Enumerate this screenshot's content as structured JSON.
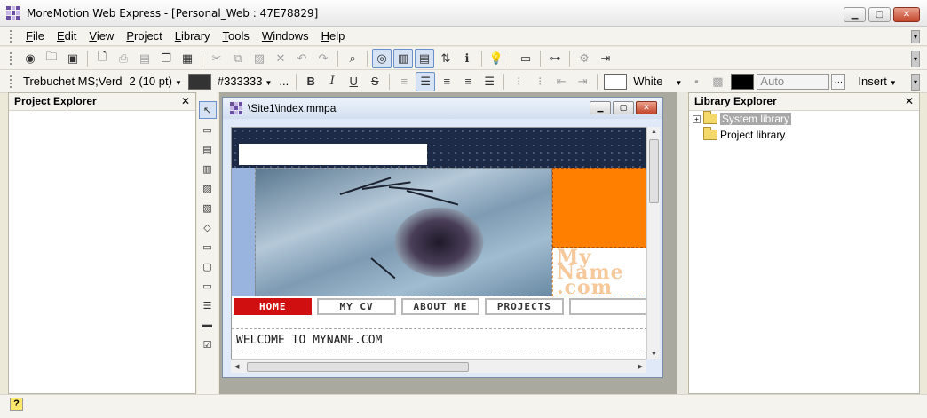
{
  "window": {
    "title": "MoreMotion Web Express - [Personal_Web : 47E78829]"
  },
  "menu": [
    "File",
    "Edit",
    "View",
    "Project",
    "Library",
    "Tools",
    "Windows",
    "Help"
  ],
  "toolbar2": {
    "font_name": "Trebuchet MS;Verd",
    "font_size": "2  (10 pt)",
    "fore_color": "#333333",
    "back_color_name": "White",
    "border_color_value": "Auto",
    "insert_label": "Insert"
  },
  "project_explorer": {
    "title": "Project Explorer"
  },
  "library_explorer": {
    "title": "Library Explorer",
    "items": [
      "System library",
      "Project library"
    ]
  },
  "document": {
    "title": "\\Site1\\index.mmpa",
    "logo_text": "My Name .com",
    "nav": [
      "HOME",
      "MY CV",
      "ABOUT ME",
      "PROJECTS"
    ],
    "welcome": "WELCOME TO MYNAME.COM"
  },
  "colors": {
    "accent": "#d01010",
    "orange": "#ff8000",
    "header": "#1c2a45"
  }
}
